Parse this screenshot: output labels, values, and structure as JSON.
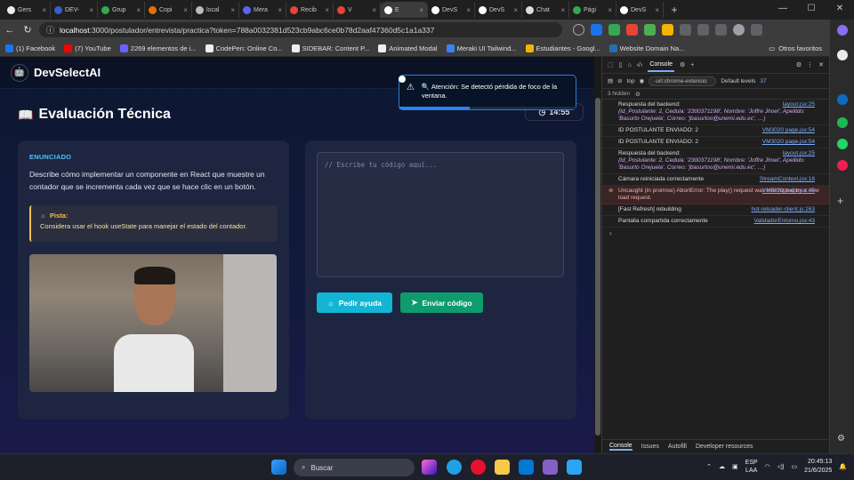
{
  "browser": {
    "tabs": [
      {
        "label": "Gers",
        "color": "#eeeeee"
      },
      {
        "label": "DEV-",
        "color": "#3b5ccc"
      },
      {
        "label": "Grup",
        "color": "#34a853"
      },
      {
        "label": "Copi",
        "color": "#e37400"
      },
      {
        "label": "local",
        "color": "#bbbbbb"
      },
      {
        "label": "Mera",
        "color": "#5865f2"
      },
      {
        "label": "Recib",
        "color": "#ea4335"
      },
      {
        "label": "V",
        "color": "#ea4335"
      },
      {
        "label": "E",
        "color": "#ffffff"
      },
      {
        "label": "DevS",
        "color": "#ffffff"
      },
      {
        "label": "DevS",
        "color": "#ffffff"
      },
      {
        "label": "Chat",
        "color": "#dddddd"
      },
      {
        "label": "Pági",
        "color": "#34a853"
      },
      {
        "label": "DevS",
        "color": "#ffffff"
      }
    ],
    "active_tab_index": 8,
    "url_host": "localhost",
    "url_rest": ":3000/postulador/entrevista/practica?token=788a0032381d523cb9abc6ce0b78d2aaf47360d5c1a1a337",
    "bookmarks": [
      {
        "label": "(1) Facebook",
        "color": "#1877f2"
      },
      {
        "label": "(7) YouTube",
        "color": "#ff0000"
      },
      {
        "label": "2269 elementos de i...",
        "color": "#6b63ff"
      },
      {
        "label": "CodePen: Online Co...",
        "color": "#eeeeee"
      },
      {
        "label": "SIDEBAR: Content P...",
        "color": "#eeeeee"
      },
      {
        "label": "Animated Modal",
        "color": "#eeeeee"
      },
      {
        "label": "Meraki UI Tailwind...",
        "color": "#3b82f6"
      },
      {
        "label": "Estudiantes - Googl...",
        "color": "#f4b400"
      },
      {
        "label": "Website Domain Na...",
        "color": "#2b6cb0"
      }
    ],
    "other_bookmarks": "Otros favoritos"
  },
  "app": {
    "brand": "DevSelectAI",
    "page_title": "Evaluación Técnica",
    "timer": "14:55",
    "toast": {
      "message": "Atención: Se detectó pérdida de foco de la ventana.",
      "progress_fraction": 0.4
    },
    "statement": {
      "label": "ENUNCIADO",
      "text": "Describe cómo implementar un componente en React que muestre un contador que se incrementa cada vez que se hace clic en un botón."
    },
    "hint": {
      "title": "Pista:",
      "text": "Considera usar el hook useState para manejar el estado del contador."
    },
    "editor_placeholder": "// Escribe tu código aquí...",
    "help_button": "Pedir ayuda",
    "submit_button": "Enviar código"
  },
  "devtools": {
    "active_tab": "Console",
    "context": "top",
    "filter": "-url:chrome-extensio",
    "levels": "Default levels",
    "issues_count": "37",
    "hidden": "3 hidden",
    "logs": [
      {
        "type": "log",
        "text": "Respuesta del backend:",
        "obj": "{Id_Postulante: 2, Cedula: '2300371198', Nombre: 'Joffre Jhoel', Apellido: 'Basurto Orejuela', Correo: 'jbasurtoo@unemi.edu.ec', …}",
        "src": "layout.jsx:25"
      },
      {
        "type": "log",
        "text": "ID POSTULANTE ENVIADO: 2",
        "obj": "",
        "src": "VM3020 page.jsx:54"
      },
      {
        "type": "log",
        "text": "ID POSTULANTE ENVIADO: 2",
        "obj": "",
        "src": "VM3020 page.jsx:54"
      },
      {
        "type": "log",
        "text": "Respuesta del backend:",
        "obj": "{Id_Postulante: 2, Cedula: '2300371198', Nombre: 'Joffre Jhoel', Apellido: 'Basurto Orejuela', Correo: 'jbasurtoo@unemi.edu.ec', …}",
        "src": "layout.jsx:25"
      },
      {
        "type": "log",
        "text": "Cámara reiniciada correctamente",
        "obj": "",
        "src": "StreamContext.jsx:18"
      },
      {
        "type": "error",
        "text": "Uncaught (in promise) AbortError: The play() request was interrupted by a new load request.",
        "obj": "",
        "src": "VM3020 page.jsx:45"
      },
      {
        "type": "log",
        "text": "[Fast Refresh] rebuilding",
        "obj": "",
        "src": "hot-reloader-client.js:163"
      },
      {
        "type": "log",
        "text": "Pantalla compartida correctamente",
        "obj": "",
        "src": "ValidadorEntorno.jsx:43"
      }
    ],
    "bottom_tabs": [
      "Console",
      "Issues",
      "Autofill",
      "Developer resources"
    ]
  },
  "taskbar": {
    "search_label": "Buscar",
    "lang": "ESP",
    "layout": "LAA",
    "time": "20:45:13",
    "date": "21/6/2025"
  }
}
